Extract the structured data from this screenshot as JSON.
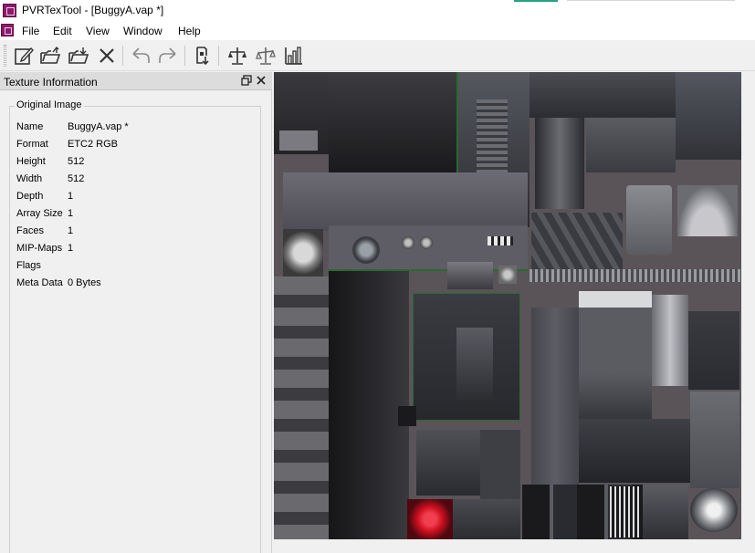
{
  "window": {
    "title": "PVRTexTool - [BuggyA.vap *]"
  },
  "menu": {
    "items": [
      "File",
      "Edit",
      "View",
      "Window",
      "Help"
    ]
  },
  "toolbar": {
    "buttons": [
      {
        "name": "edit-icon"
      },
      {
        "name": "open-folder-icon"
      },
      {
        "name": "save-folder-icon"
      },
      {
        "name": "close-x-icon"
      },
      {
        "name": "undo-icon"
      },
      {
        "name": "redo-icon"
      },
      {
        "name": "encode-icon"
      },
      {
        "name": "compare-scale-icon"
      },
      {
        "name": "compare-scale-alt-icon"
      },
      {
        "name": "histogram-icon"
      }
    ]
  },
  "panel": {
    "title": "Texture Information",
    "group_title": "Original Image",
    "properties": [
      {
        "label": "Name",
        "value": "BuggyA.vap *"
      },
      {
        "label": "Format",
        "value": "ETC2 RGB"
      },
      {
        "label": "Height",
        "value": "512"
      },
      {
        "label": "Width",
        "value": "512"
      },
      {
        "label": "Depth",
        "value": "1"
      },
      {
        "label": "Array Size",
        "value": "1"
      },
      {
        "label": "Faces",
        "value": "1"
      },
      {
        "label": "MIP-Maps",
        "value": "1"
      },
      {
        "label": "Flags",
        "value": ""
      },
      {
        "label": "Meta Data",
        "value": "0 Bytes"
      }
    ]
  },
  "colors": {
    "app_icon": "#8a1a6a",
    "accent": "#25a184",
    "texture_base": "#5a5458",
    "highlight_red": "#d01020"
  }
}
